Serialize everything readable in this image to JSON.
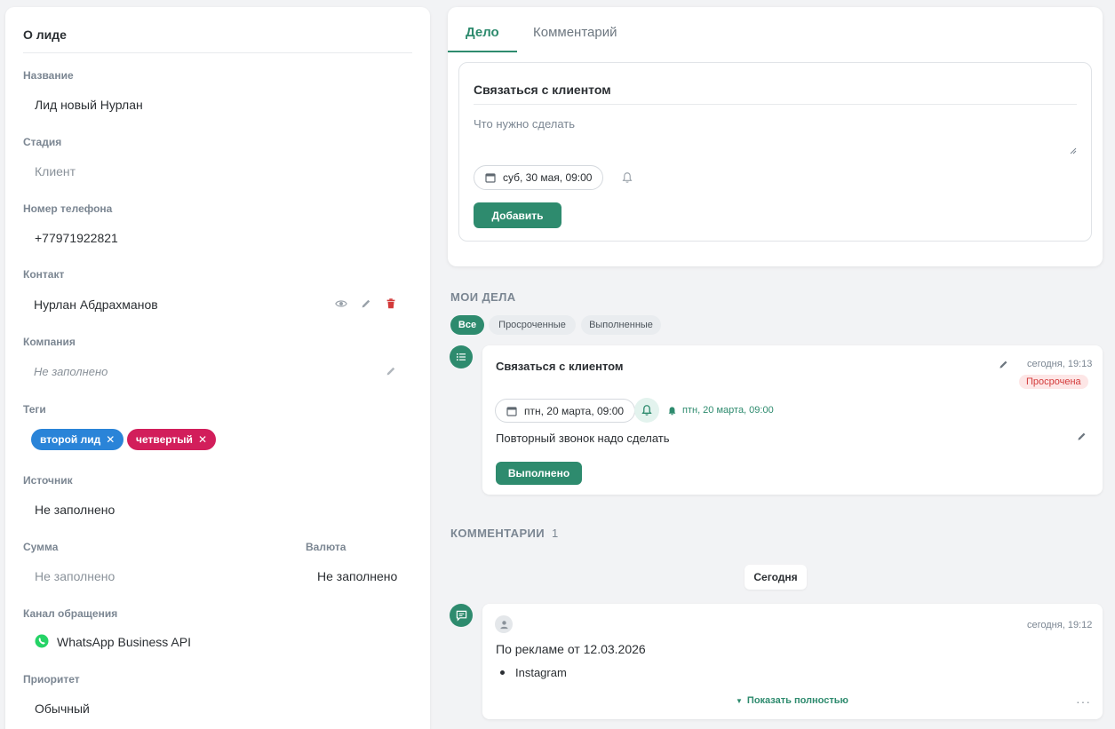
{
  "lead": {
    "header": "О лиде",
    "fields": {
      "name_label": "Название",
      "name_value": "Лид новый Нурлан",
      "stage_label": "Стадия",
      "stage_value": "Клиент",
      "phone_label": "Номер телефона",
      "phone_value": "+77971922821",
      "contact_label": "Контакт",
      "contact_value": "Нурлан Абдрахманов",
      "company_label": "Компания",
      "company_value": "Не заполнено",
      "tags_label": "Теги",
      "tags": [
        {
          "label": "второй лид",
          "color": "#2a84d8"
        },
        {
          "label": "четвертый",
          "color": "#d21e5b"
        }
      ],
      "source_label": "Источник",
      "source_value": "Не заполнено",
      "amount_label": "Сумма",
      "amount_value": "Не заполнено",
      "currency_label": "Валюта",
      "currency_value": "Не заполнено",
      "channel_label": "Канал обращения",
      "channel_value": "WhatsApp Business API",
      "priority_label": "Приоритет",
      "priority_value": "Обычный"
    }
  },
  "composer": {
    "tabs": [
      "Дело",
      "Комментарий"
    ],
    "active_tab": "Дело",
    "title": "Связаться с клиентом",
    "placeholder": "Что нужно сделать",
    "date": "суб, 30 мая, 09:00",
    "add_button": "Добавить"
  },
  "my_tasks": {
    "title": "МОИ ДЕЛА",
    "filters": [
      "Все",
      "Просроченные",
      "Выполненные"
    ],
    "active_filter": "Все",
    "task": {
      "title": "Связаться с клиентом",
      "time": "сегодня, 19:13",
      "status": "Просрочена",
      "date": "птн, 20 марта, 09:00",
      "alarm": "птн, 20 марта, 09:00",
      "text": "Повторный звонок надо сделать",
      "done_button": "Выполнено"
    }
  },
  "comments": {
    "title": "КОММЕНТАРИИ",
    "count": "1",
    "day_label": "Сегодня",
    "comment": {
      "time": "сегодня, 19:12",
      "text": "По рекламе от 12.03.2026",
      "bullet": "Instagram",
      "show_more": "Показать полностью",
      "more": "···"
    }
  },
  "colors": {
    "accent": "#2e8b6e",
    "danger": "#d33a3a",
    "whatsapp": "#25d366"
  }
}
